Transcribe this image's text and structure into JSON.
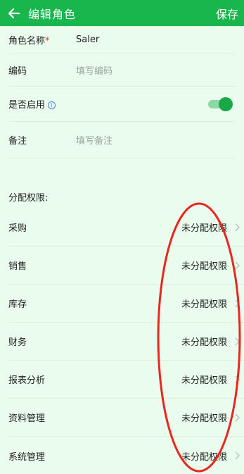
{
  "header": {
    "title": "编辑角色",
    "save_label": "保存"
  },
  "form": {
    "role_name": {
      "label": "角色名称",
      "required_mark": "*",
      "value": "Saler"
    },
    "code": {
      "label": "编码",
      "placeholder": "填写编码"
    },
    "enabled": {
      "label": "是否启用",
      "info_glyph": "i",
      "on": true
    },
    "remark": {
      "label": "备注",
      "placeholder": "填写备注"
    }
  },
  "permissions": {
    "title": "分配权限:",
    "items": [
      {
        "label": "采购",
        "status": "未分配权限"
      },
      {
        "label": "销售",
        "status": "未分配权限"
      },
      {
        "label": "库存",
        "status": "未分配权限"
      },
      {
        "label": "财务",
        "status": "未分配权限"
      },
      {
        "label": "报表分析",
        "status": "未分配权限"
      },
      {
        "label": "资料管理",
        "status": "未分配权限"
      },
      {
        "label": "系统管理",
        "status": "未分配权限"
      }
    ]
  },
  "colors": {
    "header": "#19b64d",
    "background": "#eafcee",
    "annotation": "#e8281e"
  }
}
